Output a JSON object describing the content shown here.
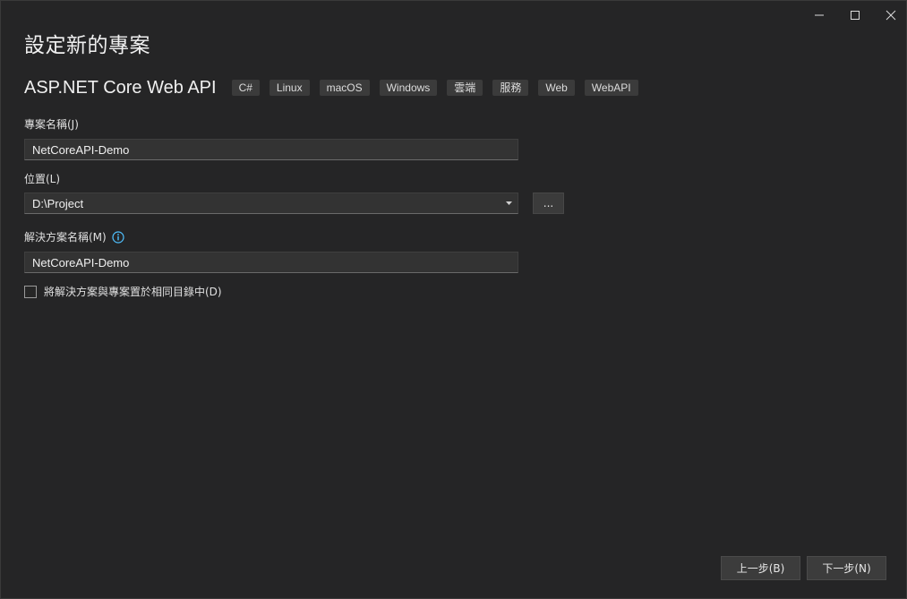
{
  "dialog": {
    "title": "設定新的專案"
  },
  "window_controls": {
    "minimize_icon": "minimize-icon",
    "maximize_icon": "maximize-icon",
    "close_icon": "close-icon"
  },
  "template": {
    "name": "ASP.NET Core Web API",
    "tags": [
      "C#",
      "Linux",
      "macOS",
      "Windows",
      "雲端",
      "服務",
      "Web",
      "WebAPI"
    ]
  },
  "project_name": {
    "label": "專案名稱(J)",
    "value": "NetCoreAPI-Demo"
  },
  "location": {
    "label": "位置(L)",
    "value": "D:\\Project",
    "browse_label": "..."
  },
  "solution_name": {
    "label": "解決方案名稱(M)",
    "value": "NetCoreAPI-Demo",
    "info_icon": "info-icon"
  },
  "same_directory": {
    "label": "將解決方案與專案置於相同目錄中(D)",
    "checked": false
  },
  "footer": {
    "back_label": "上一步(B)",
    "next_label": "下一步(N)"
  },
  "colors": {
    "background": "#252526",
    "info_accent": "#4fc1ff"
  }
}
